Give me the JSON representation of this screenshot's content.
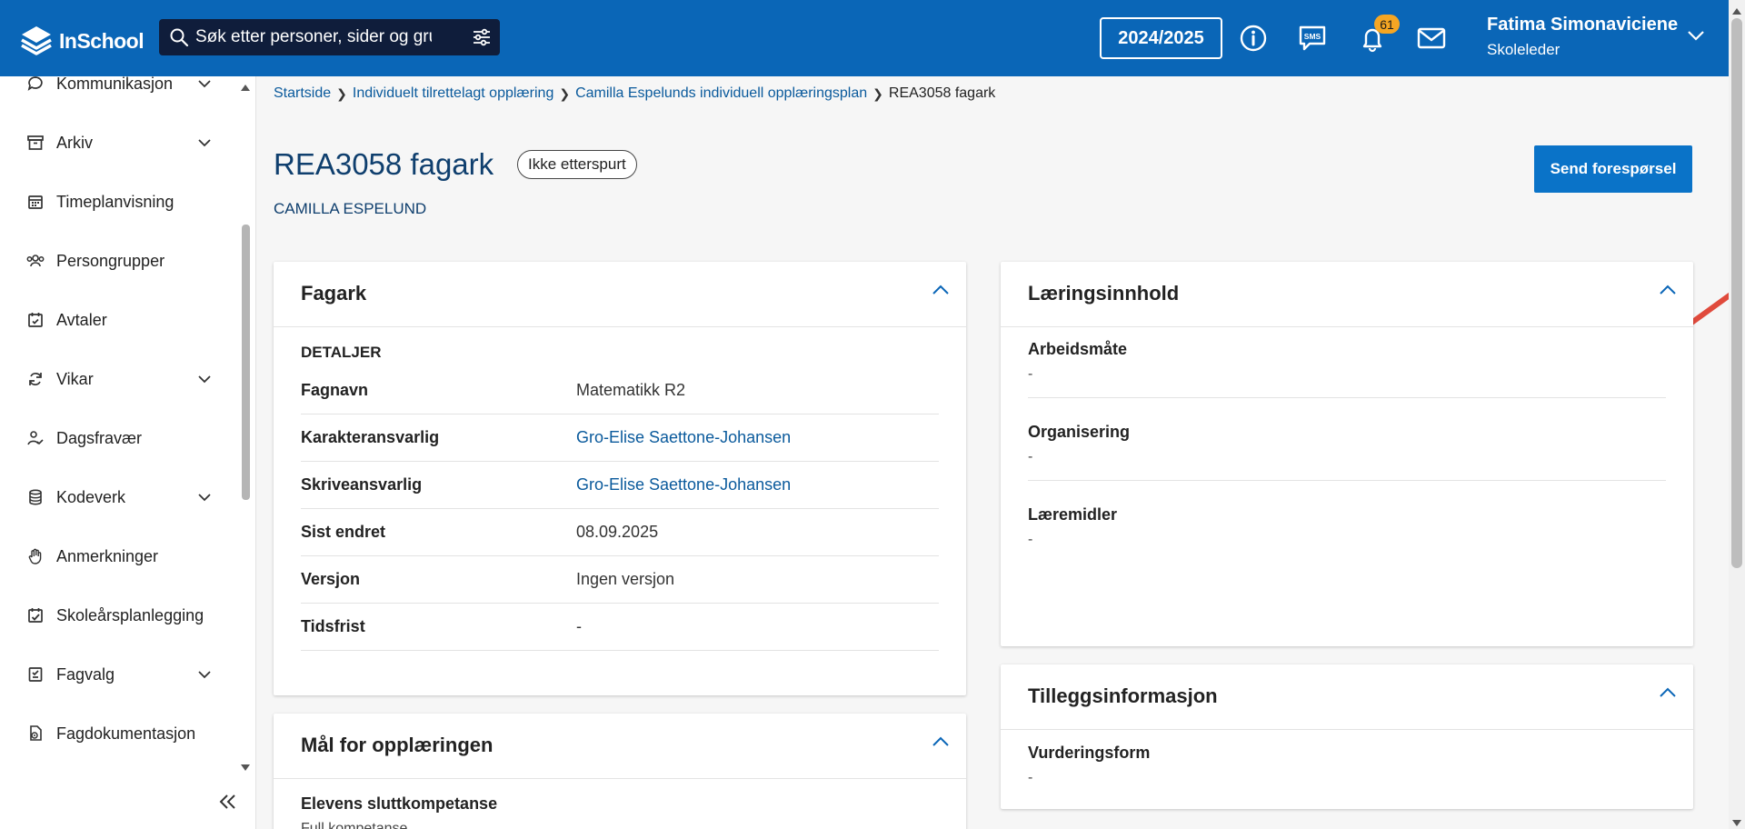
{
  "header": {
    "logo_text": "InSchool",
    "search_placeholder": "Søk etter personer, sider og grupper",
    "school_year": "2024/2025",
    "notification_count": "61",
    "user_name": "Fatima Simonaviciene",
    "user_role": "Skoleleder",
    "brand_color": "#0a66b7"
  },
  "sidebar": {
    "items": [
      {
        "label": "Kommunikasjon",
        "icon": "chat-bubble-icon",
        "expandable": true
      },
      {
        "label": "Arkiv",
        "icon": "archive-box-icon",
        "expandable": true
      },
      {
        "label": "Timeplanvisning",
        "icon": "calendar-grid-icon",
        "expandable": false
      },
      {
        "label": "Persongrupper",
        "icon": "people-group-icon",
        "expandable": false
      },
      {
        "label": "Avtaler",
        "icon": "calendar-check-icon",
        "expandable": false
      },
      {
        "label": "Vikar",
        "icon": "refresh-arrows-icon",
        "expandable": true
      },
      {
        "label": "Dagsfravær",
        "icon": "person-check-icon",
        "expandable": false
      },
      {
        "label": "Kodeverk",
        "icon": "database-icon",
        "expandable": true
      },
      {
        "label": "Anmerkninger",
        "icon": "hand-stop-icon",
        "expandable": false
      },
      {
        "label": "Skoleårsplanlegging",
        "icon": "calendar-plan-icon",
        "expandable": false
      },
      {
        "label": "Fagvalg",
        "icon": "checklist-box-icon",
        "expandable": true
      },
      {
        "label": "Fagdokumentasjon",
        "icon": "document-gear-icon",
        "expandable": false
      }
    ]
  },
  "breadcrumb": {
    "items": [
      "Startside",
      "Individuelt tilrettelagt opplæring",
      "Camilla Espelunds individuell opplæringsplan"
    ],
    "current": "REA3058 fagark"
  },
  "page": {
    "title": "REA3058 fagark",
    "status": "Ikke etterspurt",
    "student": "CAMILLA ESPELUND",
    "send_button": "Send forespørsel"
  },
  "fagark": {
    "title": "Fagark",
    "section": "DETALJER",
    "rows": [
      {
        "label": "Fagnavn",
        "value": "Matematikk R2"
      },
      {
        "label": "Karakteransvarlig",
        "value": "Gro-Elise Saettone-Johansen"
      },
      {
        "label": "Skriveansvarlig",
        "value": "Gro-Elise Saettone-Johansen"
      },
      {
        "label": "Sist endret",
        "value": "08.09.2025"
      },
      {
        "label": "Versjon",
        "value": "Ingen versjon"
      },
      {
        "label": "Tidsfrist",
        "value": "-"
      }
    ]
  },
  "maal": {
    "title": "Mål for opplæringen",
    "label": "Elevens sluttkompetanse",
    "value": "Full kompetanse"
  },
  "laeringsinnhold": {
    "title": "Læringsinnhold",
    "items": [
      {
        "label": "Arbeidsmåte",
        "value": "-"
      },
      {
        "label": "Organisering",
        "value": "-"
      },
      {
        "label": "Læremidler",
        "value": "-"
      }
    ]
  },
  "tillegg": {
    "title": "Tilleggsinformasjon",
    "items": [
      {
        "label": "Vurderingsform",
        "value": "-"
      }
    ]
  }
}
